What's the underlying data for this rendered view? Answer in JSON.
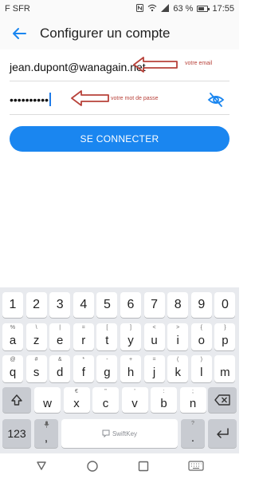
{
  "status_bar": {
    "carrier": "F SFR",
    "battery": "63 %",
    "battery_level": 0.63,
    "time": "17:55"
  },
  "app_bar": {
    "title": "Configurer un compte"
  },
  "form": {
    "email_value": "jean.dupont@wanagain.net",
    "password_dots": "••••••••••",
    "email_annotation": "votre email",
    "password_annotation": "votre mot de passe"
  },
  "login_button": {
    "label": "SE CONNECTER"
  },
  "keyboard": {
    "row_numbers": [
      "1",
      "2",
      "3",
      "4",
      "5",
      "6",
      "7",
      "8",
      "9",
      "0"
    ],
    "row1": [
      {
        "main": "a",
        "sub": "%"
      },
      {
        "main": "z",
        "sub": "\\"
      },
      {
        "main": "e",
        "sub": "|"
      },
      {
        "main": "r",
        "sub": "="
      },
      {
        "main": "t",
        "sub": "["
      },
      {
        "main": "y",
        "sub": "]"
      },
      {
        "main": "u",
        "sub": "<"
      },
      {
        "main": "i",
        "sub": ">"
      },
      {
        "main": "o",
        "sub": "{"
      },
      {
        "main": "p",
        "sub": "}"
      }
    ],
    "row2": [
      {
        "main": "q",
        "sub": "@"
      },
      {
        "main": "s",
        "sub": "#"
      },
      {
        "main": "d",
        "sub": "&"
      },
      {
        "main": "f",
        "sub": "*"
      },
      {
        "main": "g",
        "sub": "-"
      },
      {
        "main": "h",
        "sub": "+"
      },
      {
        "main": "j",
        "sub": "="
      },
      {
        "main": "k",
        "sub": "("
      },
      {
        "main": "l",
        "sub": ")"
      },
      {
        "main": "m",
        "sub": ""
      }
    ],
    "row3": [
      {
        "main": "w",
        "sub": ""
      },
      {
        "main": "x",
        "sub": "€"
      },
      {
        "main": "c",
        "sub": "\""
      },
      {
        "main": "v",
        "sub": "'"
      },
      {
        "main": "b",
        "sub": ":"
      },
      {
        "main": "n",
        "sub": ";"
      }
    ],
    "symbols_key": "123",
    "comma_key": ",",
    "comma_sub": "?",
    "period_key": ".",
    "period_sub": "?",
    "space_brand": "SwiftKey"
  },
  "icons": {
    "back": "arrow-left-icon",
    "eye": "eye-off-icon",
    "shift": "shift-icon",
    "backspace": "backspace-icon",
    "enter": "enter-icon",
    "mic": "microphone-icon"
  },
  "colors": {
    "accent": "#1a86f0",
    "annotation": "#b8423a"
  }
}
